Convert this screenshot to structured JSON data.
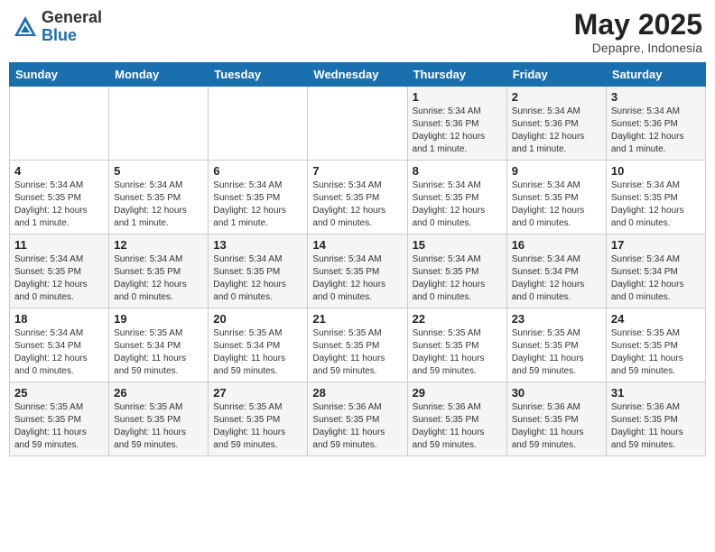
{
  "logo": {
    "general": "General",
    "blue": "Blue"
  },
  "header": {
    "month": "May 2025",
    "location": "Depapre, Indonesia"
  },
  "days_of_week": [
    "Sunday",
    "Monday",
    "Tuesday",
    "Wednesday",
    "Thursday",
    "Friday",
    "Saturday"
  ],
  "weeks": [
    [
      {
        "day": "",
        "info": ""
      },
      {
        "day": "",
        "info": ""
      },
      {
        "day": "",
        "info": ""
      },
      {
        "day": "",
        "info": ""
      },
      {
        "day": "1",
        "info": "Sunrise: 5:34 AM\nSunset: 5:36 PM\nDaylight: 12 hours\nand 1 minute."
      },
      {
        "day": "2",
        "info": "Sunrise: 5:34 AM\nSunset: 5:36 PM\nDaylight: 12 hours\nand 1 minute."
      },
      {
        "day": "3",
        "info": "Sunrise: 5:34 AM\nSunset: 5:36 PM\nDaylight: 12 hours\nand 1 minute."
      }
    ],
    [
      {
        "day": "4",
        "info": "Sunrise: 5:34 AM\nSunset: 5:35 PM\nDaylight: 12 hours\nand 1 minute."
      },
      {
        "day": "5",
        "info": "Sunrise: 5:34 AM\nSunset: 5:35 PM\nDaylight: 12 hours\nand 1 minute."
      },
      {
        "day": "6",
        "info": "Sunrise: 5:34 AM\nSunset: 5:35 PM\nDaylight: 12 hours\nand 1 minute."
      },
      {
        "day": "7",
        "info": "Sunrise: 5:34 AM\nSunset: 5:35 PM\nDaylight: 12 hours\nand 0 minutes."
      },
      {
        "day": "8",
        "info": "Sunrise: 5:34 AM\nSunset: 5:35 PM\nDaylight: 12 hours\nand 0 minutes."
      },
      {
        "day": "9",
        "info": "Sunrise: 5:34 AM\nSunset: 5:35 PM\nDaylight: 12 hours\nand 0 minutes."
      },
      {
        "day": "10",
        "info": "Sunrise: 5:34 AM\nSunset: 5:35 PM\nDaylight: 12 hours\nand 0 minutes."
      }
    ],
    [
      {
        "day": "11",
        "info": "Sunrise: 5:34 AM\nSunset: 5:35 PM\nDaylight: 12 hours\nand 0 minutes."
      },
      {
        "day": "12",
        "info": "Sunrise: 5:34 AM\nSunset: 5:35 PM\nDaylight: 12 hours\nand 0 minutes."
      },
      {
        "day": "13",
        "info": "Sunrise: 5:34 AM\nSunset: 5:35 PM\nDaylight: 12 hours\nand 0 minutes."
      },
      {
        "day": "14",
        "info": "Sunrise: 5:34 AM\nSunset: 5:35 PM\nDaylight: 12 hours\nand 0 minutes."
      },
      {
        "day": "15",
        "info": "Sunrise: 5:34 AM\nSunset: 5:35 PM\nDaylight: 12 hours\nand 0 minutes."
      },
      {
        "day": "16",
        "info": "Sunrise: 5:34 AM\nSunset: 5:34 PM\nDaylight: 12 hours\nand 0 minutes."
      },
      {
        "day": "17",
        "info": "Sunrise: 5:34 AM\nSunset: 5:34 PM\nDaylight: 12 hours\nand 0 minutes."
      }
    ],
    [
      {
        "day": "18",
        "info": "Sunrise: 5:34 AM\nSunset: 5:34 PM\nDaylight: 12 hours\nand 0 minutes."
      },
      {
        "day": "19",
        "info": "Sunrise: 5:35 AM\nSunset: 5:34 PM\nDaylight: 11 hours\nand 59 minutes."
      },
      {
        "day": "20",
        "info": "Sunrise: 5:35 AM\nSunset: 5:34 PM\nDaylight: 11 hours\nand 59 minutes."
      },
      {
        "day": "21",
        "info": "Sunrise: 5:35 AM\nSunset: 5:35 PM\nDaylight: 11 hours\nand 59 minutes."
      },
      {
        "day": "22",
        "info": "Sunrise: 5:35 AM\nSunset: 5:35 PM\nDaylight: 11 hours\nand 59 minutes."
      },
      {
        "day": "23",
        "info": "Sunrise: 5:35 AM\nSunset: 5:35 PM\nDaylight: 11 hours\nand 59 minutes."
      },
      {
        "day": "24",
        "info": "Sunrise: 5:35 AM\nSunset: 5:35 PM\nDaylight: 11 hours\nand 59 minutes."
      }
    ],
    [
      {
        "day": "25",
        "info": "Sunrise: 5:35 AM\nSunset: 5:35 PM\nDaylight: 11 hours\nand 59 minutes."
      },
      {
        "day": "26",
        "info": "Sunrise: 5:35 AM\nSunset: 5:35 PM\nDaylight: 11 hours\nand 59 minutes."
      },
      {
        "day": "27",
        "info": "Sunrise: 5:35 AM\nSunset: 5:35 PM\nDaylight: 11 hours\nand 59 minutes."
      },
      {
        "day": "28",
        "info": "Sunrise: 5:36 AM\nSunset: 5:35 PM\nDaylight: 11 hours\nand 59 minutes."
      },
      {
        "day": "29",
        "info": "Sunrise: 5:36 AM\nSunset: 5:35 PM\nDaylight: 11 hours\nand 59 minutes."
      },
      {
        "day": "30",
        "info": "Sunrise: 5:36 AM\nSunset: 5:35 PM\nDaylight: 11 hours\nand 59 minutes."
      },
      {
        "day": "31",
        "info": "Sunrise: 5:36 AM\nSunset: 5:35 PM\nDaylight: 11 hours\nand 59 minutes."
      }
    ]
  ]
}
